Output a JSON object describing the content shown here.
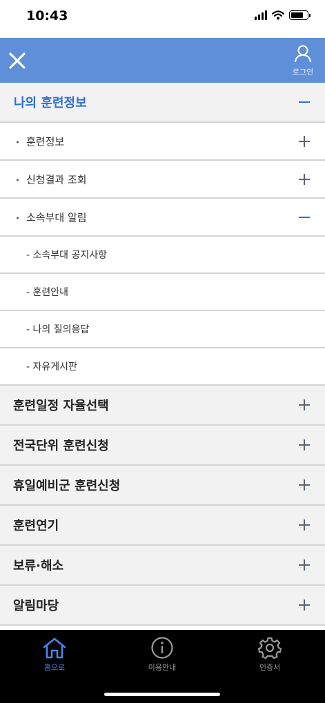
{
  "status_bar": {
    "time": "10:43"
  },
  "header": {
    "login_label": "로그인"
  },
  "menu": {
    "section_open": "나의 훈련정보",
    "sub_items": [
      "훈련정보",
      "신청결과 조회",
      "소속부대 알림"
    ],
    "subsub_items": [
      "- 소속부대 공지사항",
      "- 훈련안내",
      "- 나의 질의응답",
      "- 자유게시판"
    ],
    "sections": [
      "훈련일정 자율선택",
      "전국단위 훈련신청",
      "휴일예비군 훈련신청",
      "훈련연기",
      "보류·해소",
      "알림마당"
    ]
  },
  "tabs": [
    {
      "label": "홈으로",
      "icon": "home-icon",
      "active": true
    },
    {
      "label": "이용안내",
      "icon": "info-icon",
      "active": false
    },
    {
      "label": "인증서",
      "icon": "gear-icon",
      "active": false
    }
  ],
  "colors": {
    "header": "#5f8fd9",
    "accent": "#2f6fd6",
    "section_bg": "#f2f2f2",
    "tab_bar": "#000000"
  }
}
